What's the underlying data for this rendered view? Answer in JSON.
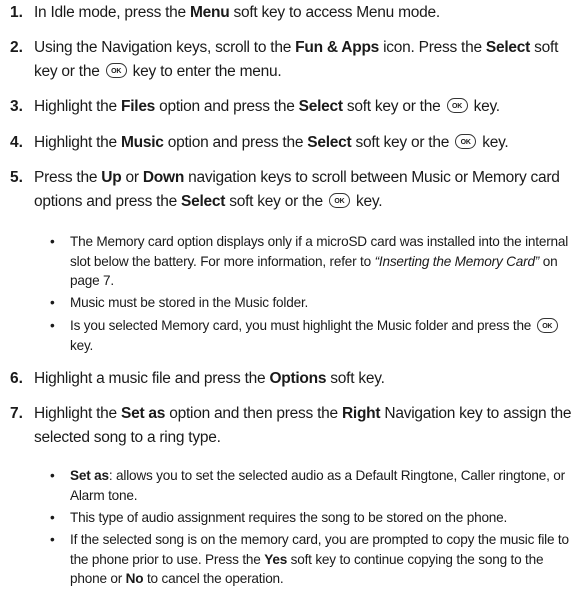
{
  "ok_key_label": "OK",
  "steps": [
    {
      "num": "1.",
      "parts": [
        [
          "t",
          "In Idle mode, press the "
        ],
        [
          "b",
          "Menu"
        ],
        [
          "t",
          " soft key to access Menu mode."
        ]
      ]
    },
    {
      "num": "2.",
      "parts": [
        [
          "t",
          "Using the Navigation keys, scroll to the "
        ],
        [
          "b",
          "Fun & Apps"
        ],
        [
          "t",
          " icon. Press the "
        ],
        [
          "b",
          "Select"
        ],
        [
          "t",
          " soft key or the "
        ],
        [
          "ok",
          ""
        ],
        [
          "t",
          " key to enter the menu."
        ]
      ]
    },
    {
      "num": "3.",
      "parts": [
        [
          "t",
          "Highlight the "
        ],
        [
          "b",
          "Files"
        ],
        [
          "t",
          " option and press the "
        ],
        [
          "b",
          "Select"
        ],
        [
          "t",
          " soft key or the "
        ],
        [
          "ok",
          ""
        ],
        [
          "t",
          " key."
        ]
      ]
    },
    {
      "num": "4.",
      "parts": [
        [
          "t",
          "Highlight the "
        ],
        [
          "b",
          "Music"
        ],
        [
          "t",
          " option and press the "
        ],
        [
          "b",
          "Select"
        ],
        [
          "t",
          " soft key or the "
        ],
        [
          "ok",
          ""
        ],
        [
          "t",
          " key."
        ]
      ]
    },
    {
      "num": "5.",
      "parts": [
        [
          "t",
          "Press the "
        ],
        [
          "b",
          "Up"
        ],
        [
          "t",
          " or "
        ],
        [
          "b",
          "Down"
        ],
        [
          "t",
          " navigation keys to scroll between Music or Memory card options and press the "
        ],
        [
          "b",
          "Select"
        ],
        [
          "t",
          " soft key or the "
        ],
        [
          "ok",
          ""
        ],
        [
          "t",
          " key."
        ]
      ]
    },
    {
      "num": "6.",
      "parts": [
        [
          "t",
          "Highlight a music file and press the "
        ],
        [
          "b",
          "Options"
        ],
        [
          "t",
          " soft key."
        ]
      ]
    },
    {
      "num": "7.",
      "parts": [
        [
          "t",
          "Highlight the "
        ],
        [
          "b",
          "Set as"
        ],
        [
          "t",
          " option and then press the "
        ],
        [
          "b",
          "Right"
        ],
        [
          "t",
          " Navigation key to assign the selected song to a ring type."
        ]
      ]
    }
  ],
  "bullets": [
    {
      "parts": [
        [
          "t",
          "The Memory card option displays only if a microSD card was installed into the internal slot below the battery. For more information, refer to "
        ],
        [
          "i",
          "“Inserting the Memory Card”"
        ],
        [
          "t",
          "  on page 7."
        ]
      ]
    },
    {
      "parts": [
        [
          "t",
          "Music must be stored in the Music folder."
        ]
      ]
    },
    {
      "parts": [
        [
          "t",
          "Is you selected Memory card, you must highlight the Music folder and press the "
        ],
        [
          "ok",
          ""
        ],
        [
          "t",
          " key."
        ]
      ]
    },
    {
      "parts": [
        [
          "b",
          "Set as"
        ],
        [
          "t",
          ": allows you to set the selected audio as a Default Ringtone, Caller ringtone, or Alarm tone."
        ]
      ]
    },
    {
      "parts": [
        [
          "t",
          "This type of audio assignment requires the song to be stored on the phone."
        ]
      ]
    },
    {
      "parts": [
        [
          "t",
          "If the selected song is on the memory card, you are prompted to copy the music file to the phone prior to use. Press the "
        ],
        [
          "b",
          "Yes"
        ],
        [
          "t",
          " soft key to continue copying the song to the phone or "
        ],
        [
          "b",
          "No"
        ],
        [
          "t",
          " to cancel the operation."
        ]
      ]
    }
  ]
}
